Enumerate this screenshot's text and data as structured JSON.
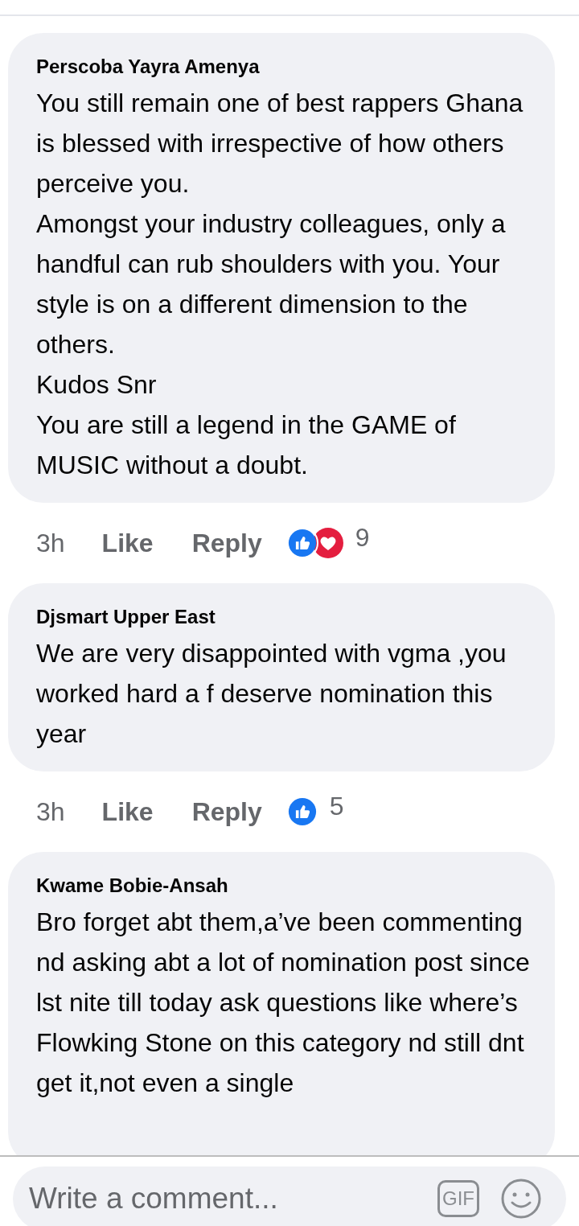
{
  "comments": [
    {
      "author": "Perscoba Yayra Amenya",
      "text": "You still remain one of best rappers Ghana is blessed with irrespective of how others perceive you.\nAmongst your industry colleagues, only a handful can rub shoulders with you. Your style is on a different dimension to the others.\nKudos Snr\nYou are still a legend in the GAME of MUSIC without a doubt.",
      "time": "3h",
      "like": "Like",
      "reply": "Reply",
      "reactions": [
        {
          "kind": "like"
        },
        {
          "kind": "love"
        }
      ],
      "count": "9"
    },
    {
      "author": "Djsmart Upper East",
      "text": "We are very disappointed with vgma ,you worked hard a f deserve nomination this year",
      "time": "3h",
      "like": "Like",
      "reply": "Reply",
      "reactions": [
        {
          "kind": "like"
        }
      ],
      "count": "5"
    },
    {
      "author": "Kwame Bobie-Ansah",
      "text": "Bro forget abt them,a’ve been commenting nd asking abt a lot of nomination post since lst nite till today ask questions like where’s Flowking Stone on this category nd still dnt get it,not even a single"
    }
  ],
  "composer": {
    "placeholder": "Write a comment...",
    "gif": "GIF"
  }
}
